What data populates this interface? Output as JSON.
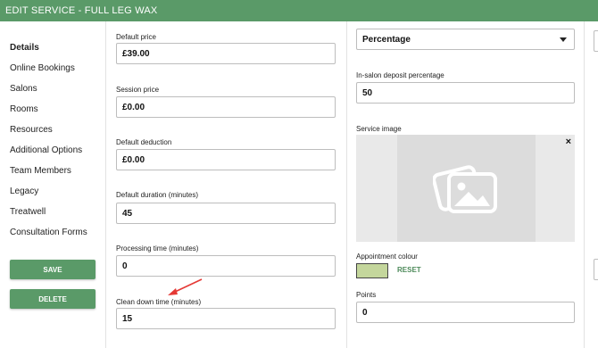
{
  "header": {
    "title": "EDIT SERVICE - FULL LEG WAX"
  },
  "sidebar": {
    "items": [
      {
        "label": "Details"
      },
      {
        "label": "Online Bookings"
      },
      {
        "label": "Salons"
      },
      {
        "label": "Rooms"
      },
      {
        "label": "Resources"
      },
      {
        "label": "Additional Options"
      },
      {
        "label": "Team Members"
      },
      {
        "label": "Legacy"
      },
      {
        "label": "Treatwell"
      },
      {
        "label": "Consultation Forms"
      }
    ],
    "save_label": "SAVE",
    "delete_label": "DELETE"
  },
  "form_left": {
    "default_price": {
      "label": "Default price",
      "value": "£39.00"
    },
    "session_price": {
      "label": "Session price",
      "value": "£0.00"
    },
    "default_deduction": {
      "label": "Default deduction",
      "value": "£0.00"
    },
    "default_duration": {
      "label": "Default duration (minutes)",
      "value": "45"
    },
    "processing_time": {
      "label": "Processing time (minutes)",
      "value": "0"
    },
    "clean_down_time": {
      "label": "Clean down time (minutes)",
      "value": "15"
    }
  },
  "form_right": {
    "deposit_type": {
      "value": "Percentage"
    },
    "deposit_percentage": {
      "label": "In-salon deposit  percentage",
      "value": "50"
    },
    "service_image": {
      "label": "Service image",
      "close": "×"
    },
    "appointment_colour": {
      "label": "Appointment colour",
      "color": "#c4d69c",
      "reset_label": "RESET"
    },
    "points": {
      "label": "Points",
      "value": "0"
    }
  },
  "colors": {
    "accent": "#5a9a68",
    "annotation_arrow": "#e53935"
  },
  "icons": {
    "caret": "chevron-down-icon",
    "image_placeholder": "image-placeholder-icon",
    "close": "close-icon"
  }
}
